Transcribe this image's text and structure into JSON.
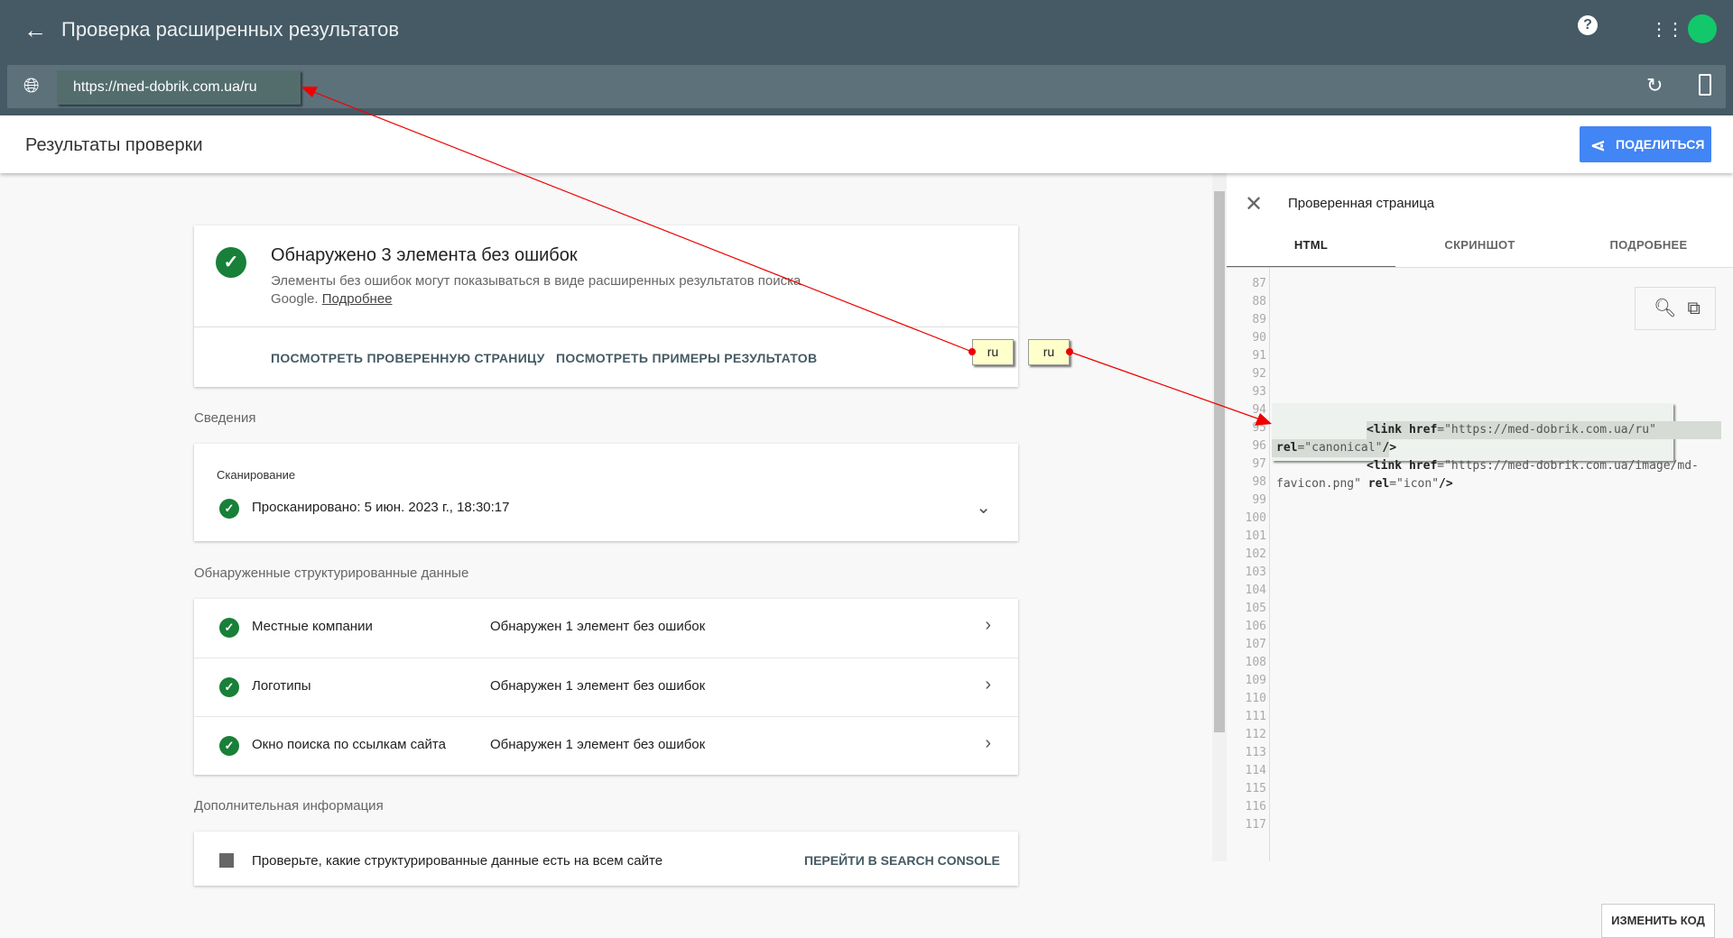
{
  "header": {
    "title": "Проверка расширенных результатов",
    "url": "https://med-dobrik.com.ua/ru"
  },
  "results": {
    "title": "Результаты проверки",
    "share_label": "ПОДЕЛИТЬСЯ"
  },
  "summary": {
    "title": "Обнаружено 3 элемента без ошибок",
    "desc": "Элементы без ошибок могут показываться в виде расширенных результатов поиска Google.",
    "more_link": "Подробнее",
    "action1": "ПОСМОТРЕТЬ ПРОВЕРЕННУЮ СТРАНИЦУ",
    "action2": "ПОСМОТРЕТЬ ПРИМЕРЫ РЕЗУЛЬТАТОВ"
  },
  "details": {
    "heading": "Сведения",
    "scan_label": "Сканирование",
    "scan_value": "Просканировано: 5 июн. 2023 г., 18:30:17"
  },
  "structured": {
    "heading": "Обнаруженные структурированные данные",
    "items": [
      {
        "name": "Местные компании",
        "status": "Обнаружен 1 элемент без ошибок"
      },
      {
        "name": "Логотипы",
        "status": "Обнаружен 1 элемент без ошибок"
      },
      {
        "name": "Окно поиска по ссылкам сайта",
        "status": "Обнаружен 1 элемент без ошибок"
      }
    ]
  },
  "extra": {
    "heading": "Дополнительная информация",
    "text": "Проверьте, какие структурированные данные есть на всем сайте",
    "link": "ПЕРЕЙТИ В SEARCH CONSOLE"
  },
  "panel": {
    "title": "Проверенная страница",
    "tabs": [
      "HTML",
      "СКРИНШОТ",
      "ПОДРОБНЕЕ"
    ],
    "edit_label": "ИЗМЕНИТЬ КОД",
    "line_numbers": [
      "87",
      "88",
      "89",
      "90",
      "91",
      "92",
      "93",
      "94",
      "95",
      "96",
      "97",
      "98",
      "99",
      "100",
      "101",
      "102",
      "103",
      "104",
      "105",
      "106",
      "107",
      "108",
      "109",
      "110",
      "111",
      "112",
      "113",
      "114",
      "115",
      "116",
      "117"
    ]
  },
  "annotations": {
    "note1": "ru",
    "note2": "ru"
  }
}
